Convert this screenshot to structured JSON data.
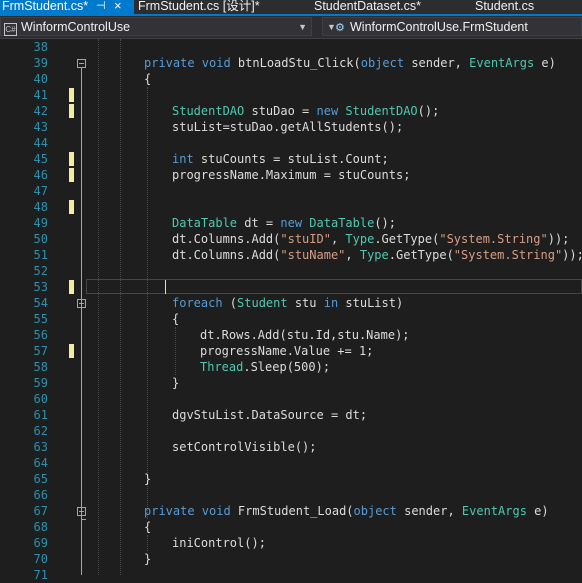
{
  "tabs": [
    {
      "label": "FrmStudent.cs*",
      "pin": "⊣",
      "close": "×"
    },
    {
      "label": "FrmStudent.cs [设计]*"
    },
    {
      "label": "StudentDataset.cs*"
    },
    {
      "label": "Student.cs"
    }
  ],
  "nav": {
    "project": "WinformControlUse",
    "type": "WinformControlUse.FrmStudent"
  },
  "editor": {
    "line_numbers": [
      "38",
      "39",
      "40",
      "41",
      "42",
      "43",
      "44",
      "45",
      "46",
      "47",
      "48",
      "49",
      "50",
      "51",
      "52",
      "53",
      "54",
      "55",
      "56",
      "57",
      "58",
      "59",
      "60",
      "61",
      "62",
      "63",
      "64",
      "65",
      "66",
      "67",
      "68",
      "69",
      "70",
      "71"
    ],
    "colors": {
      "keyword": "#569cd6",
      "type": "#4ec9b0",
      "string": "#d69d85",
      "text": "#dcdcdc",
      "linenum": "#2b91af",
      "changed": "#efef9f"
    },
    "code": {
      "l39a": "private void ",
      "l39b": "btnLoadStu_Click(",
      "l39c": "object",
      "l39d": " sender, ",
      "l39e": "EventArgs",
      "l39f": " e)",
      "l40": "{",
      "l42a": "StudentDAO",
      "l42b": " stuDao = ",
      "l42c": "new ",
      "l42d": "StudentDAO",
      "l42e": "();",
      "l43": "stuList=stuDao.getAllStudents();",
      "l45a": "int",
      "l45b": " stuCounts = stuList.Count;",
      "l46": "progressName.Maximum = stuCounts;",
      "l49a": "DataTable",
      "l49b": " dt = ",
      "l49c": "new ",
      "l49d": "DataTable",
      "l49e": "();",
      "l50a": "dt.Columns.Add(",
      "l50b": "\"stuID\"",
      "l50c": ", ",
      "l50d": "Type",
      "l50e": ".GetType(",
      "l50f": "\"System.String\"",
      "l50g": "));",
      "l51a": "dt.Columns.Add(",
      "l51b": "\"stuName\"",
      "l51c": ", ",
      "l51d": "Type",
      "l51e": ".GetType(",
      "l51f": "\"System.String\"",
      "l51g": "));",
      "l54a": "foreach",
      "l54b": " (",
      "l54c": "Student",
      "l54d": " stu ",
      "l54e": "in",
      "l54f": " stuList)",
      "l55": "{",
      "l56": "dt.Rows.Add(stu.Id,stu.Name);",
      "l57": "progressName.Value += 1;",
      "l58a": "Thread",
      "l58b": ".Sleep(500);",
      "l59": "}",
      "l61": "dgvStuList.DataSource = dt;",
      "l63": "setControlVisible();",
      "l65": "}",
      "l67a": "private void ",
      "l67b": "FrmStudent_Load(",
      "l67c": "object",
      "l67d": " sender, ",
      "l67e": "EventArgs",
      "l67f": " e)",
      "l68": "{",
      "l69": "iniControl();",
      "l70": "}"
    }
  }
}
